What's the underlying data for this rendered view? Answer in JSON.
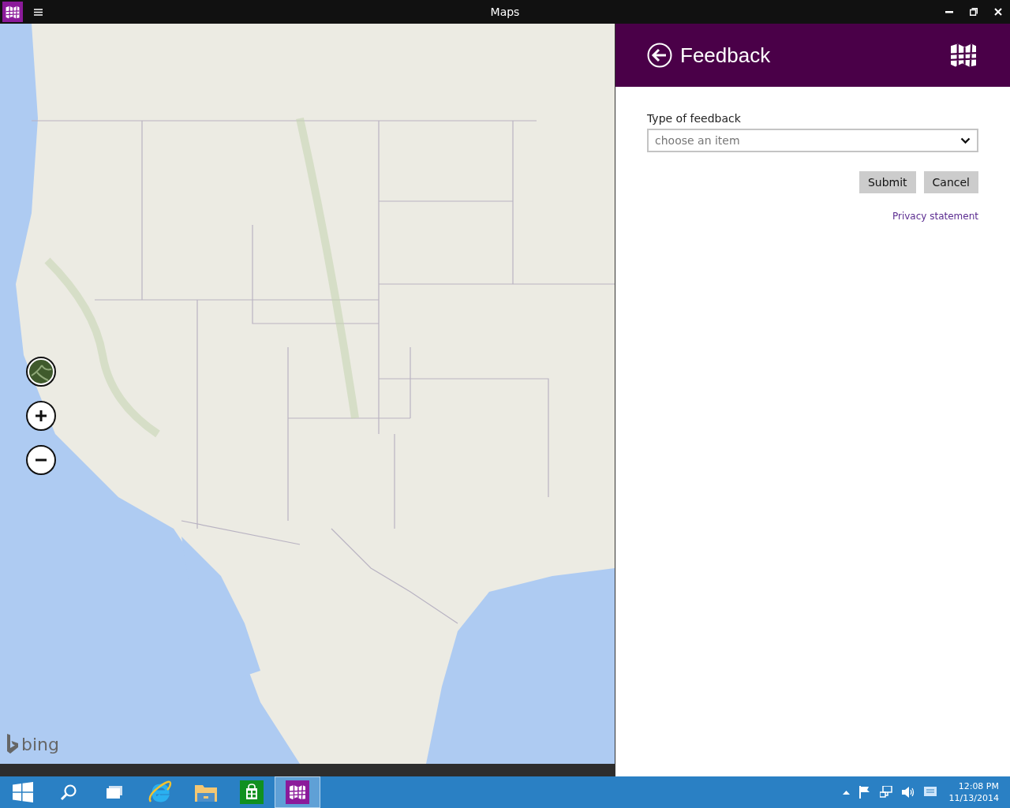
{
  "window": {
    "title": "Maps"
  },
  "map": {
    "logo": "bing",
    "controls": [
      {
        "kind": "layers"
      },
      {
        "kind": "zoom_in"
      },
      {
        "kind": "zoom_out"
      }
    ]
  },
  "panel": {
    "title": "Feedback",
    "field": {
      "label": "Type of feedback",
      "placeholder": "choose an item"
    },
    "buttons": [
      "Submit",
      "Cancel"
    ],
    "link": "Privacy statement"
  },
  "taskbar": {
    "items": [
      {
        "kind": "start",
        "selected": false
      },
      {
        "kind": "search",
        "selected": false
      },
      {
        "kind": "task_view",
        "selected": false
      },
      {
        "kind": "browser",
        "selected": false
      },
      {
        "kind": "files",
        "selected": false
      },
      {
        "kind": "store",
        "selected": false
      },
      {
        "kind": "maps",
        "selected": true
      }
    ],
    "tray": [
      {
        "kind": "chevron"
      },
      {
        "kind": "flag"
      },
      {
        "kind": "network"
      },
      {
        "kind": "volume"
      },
      {
        "kind": "notification"
      }
    ],
    "clock": {
      "time": "12:08 PM",
      "date": "11/13/2014"
    }
  }
}
